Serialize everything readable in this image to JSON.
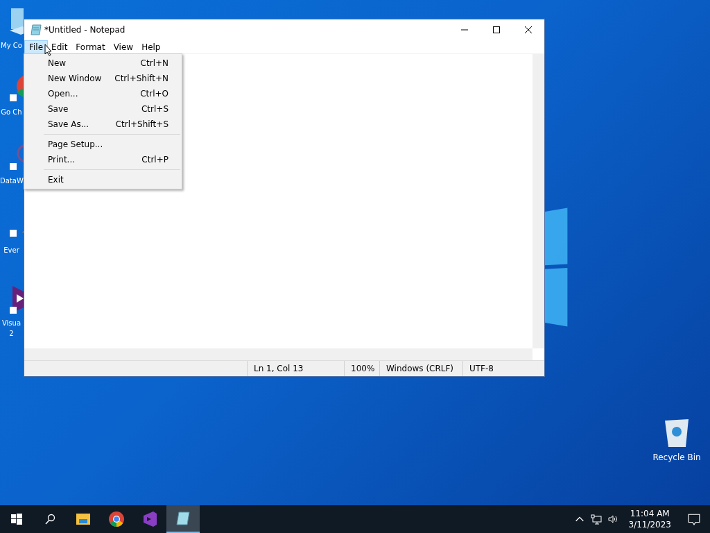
{
  "desktop_icons": [
    {
      "kind": "computer",
      "label": "My Co"
    },
    {
      "kind": "chrome",
      "label": "Go Ch"
    },
    {
      "kind": "network",
      "label": "DataW"
    },
    {
      "kind": "orange",
      "label": "Ever"
    },
    {
      "kind": "vstudio",
      "label": "Visua 2"
    }
  ],
  "recycle_bin": {
    "label": "Recycle Bin"
  },
  "window": {
    "title": "*Untitled - Notepad",
    "menus": [
      {
        "label": "File",
        "selected": true
      },
      {
        "label": "Edit",
        "selected": false
      },
      {
        "label": "Format",
        "selected": false
      },
      {
        "label": "View",
        "selected": false
      },
      {
        "label": "Help",
        "selected": false
      }
    ],
    "file_menu": [
      {
        "kind": "item",
        "label": "New",
        "shortcut": "Ctrl+N"
      },
      {
        "kind": "item",
        "label": "New Window",
        "shortcut": "Ctrl+Shift+N"
      },
      {
        "kind": "item",
        "label": "Open...",
        "shortcut": "Ctrl+O"
      },
      {
        "kind": "item",
        "label": "Save",
        "shortcut": "Ctrl+S"
      },
      {
        "kind": "item",
        "label": "Save As...",
        "shortcut": "Ctrl+Shift+S"
      },
      {
        "kind": "separator"
      },
      {
        "kind": "item",
        "label": "Page Setup..."
      },
      {
        "kind": "item",
        "label": "Print...",
        "shortcut": "Ctrl+P"
      },
      {
        "kind": "separator"
      },
      {
        "kind": "item",
        "label": "Exit"
      }
    ],
    "status_bar": [
      "Ln 1, Col 13",
      "100%",
      "Windows (CRLF)",
      "UTF-8"
    ]
  },
  "taskbar": {
    "apps": [
      {
        "kind": "explorer",
        "active": false
      },
      {
        "kind": "chrome",
        "active": false
      },
      {
        "kind": "vstudio",
        "active": false
      },
      {
        "kind": "notepad",
        "active": true
      }
    ],
    "time": "11:04 AM",
    "date": "3/11/2023"
  }
}
